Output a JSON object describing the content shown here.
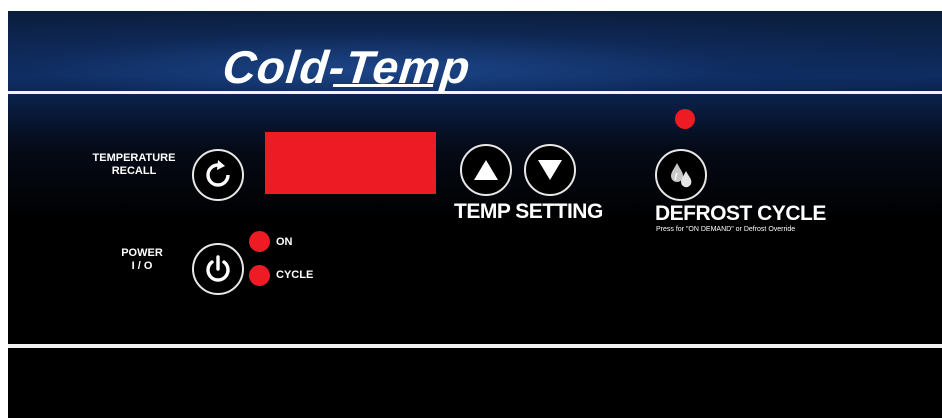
{
  "brand": {
    "logo_text": "Cold-Temp"
  },
  "temperature_recall": {
    "label_line1": "TEMPERATURE",
    "label_line2": "RECALL",
    "icon": "refresh-icon"
  },
  "display": {
    "color": "#ed1c24"
  },
  "power": {
    "label_line1": "POWER",
    "label_line2": "I / O",
    "icon": "power-icon"
  },
  "indicators": {
    "on_label": "ON",
    "cycle_label": "CYCLE",
    "color": "#ed1c24"
  },
  "temp_setting": {
    "label": "TEMP SETTING",
    "up_icon": "triangle-up-icon",
    "down_icon": "triangle-down-icon"
  },
  "defrost": {
    "label": "DEFROST CYCLE",
    "note": "Press for \"ON DEMAND\" or Defrost Override",
    "icon": "droplets-icon"
  }
}
